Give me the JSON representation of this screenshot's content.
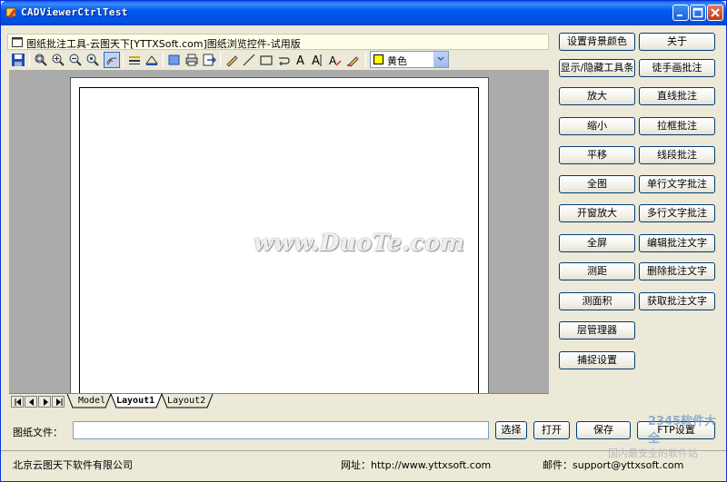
{
  "window": {
    "title": "CADViewerCtrlTest",
    "controls": [
      "minimize-icon",
      "maximize-icon",
      "close-icon"
    ]
  },
  "header": {
    "text": "图纸批注工具-云图天下[YTTXSoft.com]图纸浏览控件-试用版"
  },
  "toolbar": {
    "color_select": {
      "selected": "黄色",
      "swatch_color": "#FFFF00"
    }
  },
  "canvas": {
    "watermark": "www.DuoTe.com"
  },
  "sheet_tabs": [
    "Model",
    "Layout1",
    "Layout2"
  ],
  "active_sheet": "Layout1",
  "buttons": {
    "set_bg_color": "设置背景颜色",
    "about": "关于",
    "toggle_toolbar": "显示/隐藏工具条",
    "freehand_annot": "徒手画批注",
    "zoom_in": "放大",
    "line_annot": "直线批注",
    "zoom_out": "缩小",
    "box_annot": "拉框批注",
    "pan": "平移",
    "segment_annot": "线段批注",
    "full_view": "全图",
    "single_text_annot": "单行文字批注",
    "window_zoom": "开窗放大",
    "multi_text_annot": "多行文字批注",
    "full_screen": "全屏",
    "edit_text_annot": "编辑批注文字",
    "measure_distance": "测距",
    "delete_text_annot": "删除批注文字",
    "measure_area": "测面积",
    "get_text_annot": "获取批注文字",
    "layer_manager": "层管理器",
    "snap_settings": "捕捉设置"
  },
  "file_row": {
    "label": "图纸文件：",
    "value": "",
    "select": "选择",
    "open": "打开",
    "save": "保存",
    "ftp": "FTP设置"
  },
  "footer": {
    "company": "北京云图天下软件有限公司",
    "website": "网址：http://www.yttxsoft.com",
    "email": "邮件：support@yttxsoft.com"
  },
  "overlay_watermark": {
    "logo": "2345软件大全",
    "site": "www.DuoTe.com",
    "slogan": "国内最安全的软件站"
  }
}
